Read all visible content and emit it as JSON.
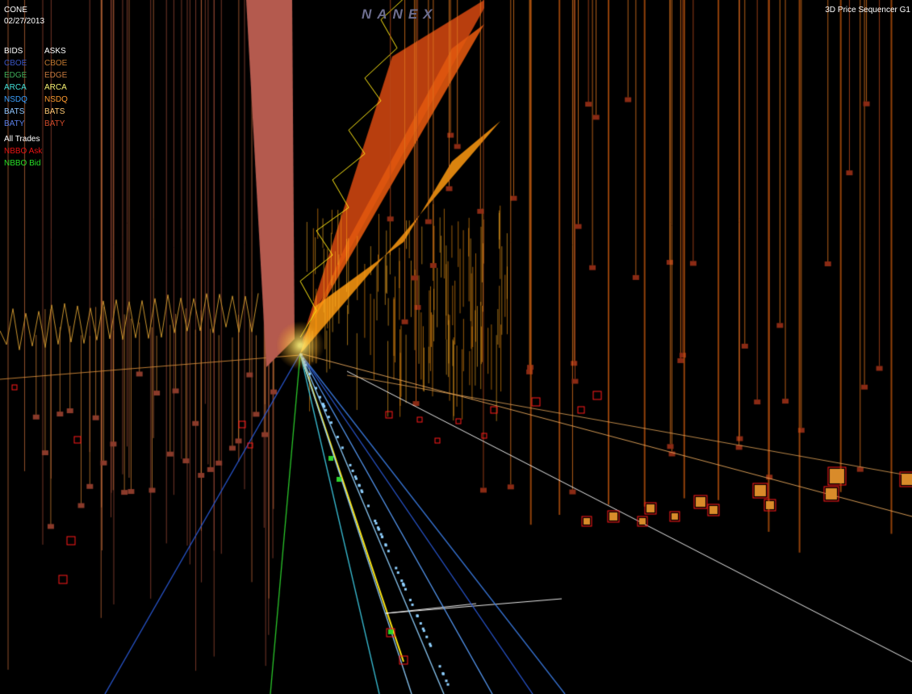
{
  "window": {
    "symbol": "CONE",
    "date": "02/27/2013",
    "brand": "NANEX",
    "app_title": "3D Price Sequencer G1"
  },
  "legend": {
    "bids": [
      {
        "label": "BIDS",
        "color": "#ffffff"
      },
      {
        "label": "CBOE",
        "color": "#3a55c4"
      },
      {
        "label": "EDGE",
        "color": "#3fae5a"
      },
      {
        "label": "ARCA",
        "color": "#44e0d8"
      },
      {
        "label": "NSDQ",
        "color": "#3aa0ff"
      },
      {
        "label": "BATS",
        "color": "#8fc6ff"
      },
      {
        "label": "BATY",
        "color": "#5a7fe8"
      }
    ],
    "asks": [
      {
        "label": "ASKS",
        "color": "#ffffff"
      },
      {
        "label": "CBOE",
        "color": "#c27830"
      },
      {
        "label": "EDGE",
        "color": "#c77a3e"
      },
      {
        "label": "ARCA",
        "color": "#f5f072"
      },
      {
        "label": "NSDQ",
        "color": "#ff9a2e"
      },
      {
        "label": "BATS",
        "color": "#ffc873"
      },
      {
        "label": "BATY",
        "color": "#d24a2a"
      }
    ],
    "extra": [
      {
        "label": "All Trades",
        "color": "#ffffff"
      },
      {
        "label": "NBBO Ask",
        "color": "#e81212"
      },
      {
        "label": "NBBO Bid",
        "color": "#26e026"
      }
    ]
  },
  "colors": {
    "background": "#000000",
    "brand": "#6d6e8f",
    "bats_bid_wall": "#b45a4e",
    "arca_ask": "#ffe814",
    "nsdq_ask": "#ff9a10",
    "edge_ask": "#e0560e",
    "baty_ask": "#c2410f",
    "trade_box": "#ff1a1a",
    "trade_fill": "#d98b2a",
    "bid_blue": "#2a5ad8",
    "bid_cyan": "#3cc8e0",
    "bid_light": "#8fd0ff",
    "nbbo_bid": "#2cd12c",
    "all_trades": "#ffffff",
    "horizon_orange": "#f4b060"
  },
  "icons": {
    "trade_marker": "red-square-outline-icon",
    "quote_marker": "orange-cube-icon"
  }
}
